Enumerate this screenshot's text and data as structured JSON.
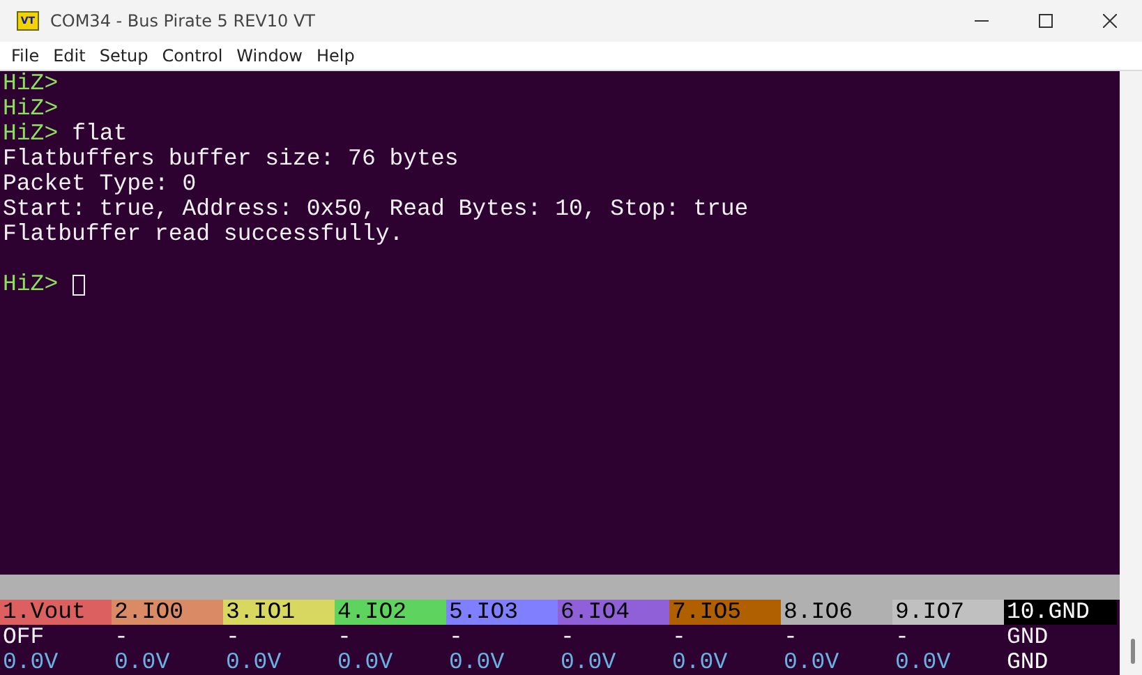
{
  "window": {
    "title": "COM34 - Bus Pirate 5 REV10 VT",
    "icon_text": "VT"
  },
  "menu": [
    "File",
    "Edit",
    "Setup",
    "Control",
    "Window",
    "Help"
  ],
  "terminal": {
    "lines": [
      {
        "kind": "prompt",
        "prompt": "HiZ>"
      },
      {
        "kind": "prompt",
        "prompt": "HiZ>"
      },
      {
        "kind": "prompt",
        "prompt": "HiZ>",
        "command": "flat"
      },
      {
        "kind": "output",
        "text": "Flatbuffers buffer size: 76 bytes"
      },
      {
        "kind": "output",
        "text": "Packet Type: 0"
      },
      {
        "kind": "output",
        "text": "Start: true, Address: 0x50, Read Bytes: 10, Stop: true"
      },
      {
        "kind": "output",
        "text": "Flatbuffer read successfully."
      },
      {
        "kind": "blank"
      },
      {
        "kind": "prompt",
        "prompt": "HiZ>",
        "cursor": true
      }
    ]
  },
  "pins": [
    {
      "kind": "io",
      "label": "1.Vout",
      "color": "#dc6060",
      "state": "OFF",
      "voltage": "0.0V"
    },
    {
      "kind": "io",
      "label": "2.IO0",
      "color": "#da8a64",
      "state": "-",
      "voltage": "0.0V"
    },
    {
      "kind": "io",
      "label": "3.IO1",
      "color": "#d8d860",
      "state": "-",
      "voltage": "0.0V"
    },
    {
      "kind": "io",
      "label": "4.IO2",
      "color": "#5ed45e",
      "state": "-",
      "voltage": "0.0V"
    },
    {
      "kind": "io",
      "label": "5.IO3",
      "color": "#8080ff",
      "state": "-",
      "voltage": "0.0V"
    },
    {
      "kind": "io",
      "label": "6.IO4",
      "color": "#9060d8",
      "state": "-",
      "voltage": "0.0V"
    },
    {
      "kind": "io",
      "label": "7.IO5",
      "color": "#b06000",
      "state": "-",
      "voltage": "0.0V"
    },
    {
      "kind": "io",
      "label": "8.IO6",
      "color": "#b0b0b0",
      "state": "-",
      "voltage": "0.0V"
    },
    {
      "kind": "io",
      "label": "9.IO7",
      "color": "#c0c0c0",
      "state": "-",
      "voltage": "0.0V"
    },
    {
      "kind": "ground",
      "label": "10.GND",
      "color": "#000000",
      "state": "GND",
      "voltage": "GND"
    }
  ]
}
